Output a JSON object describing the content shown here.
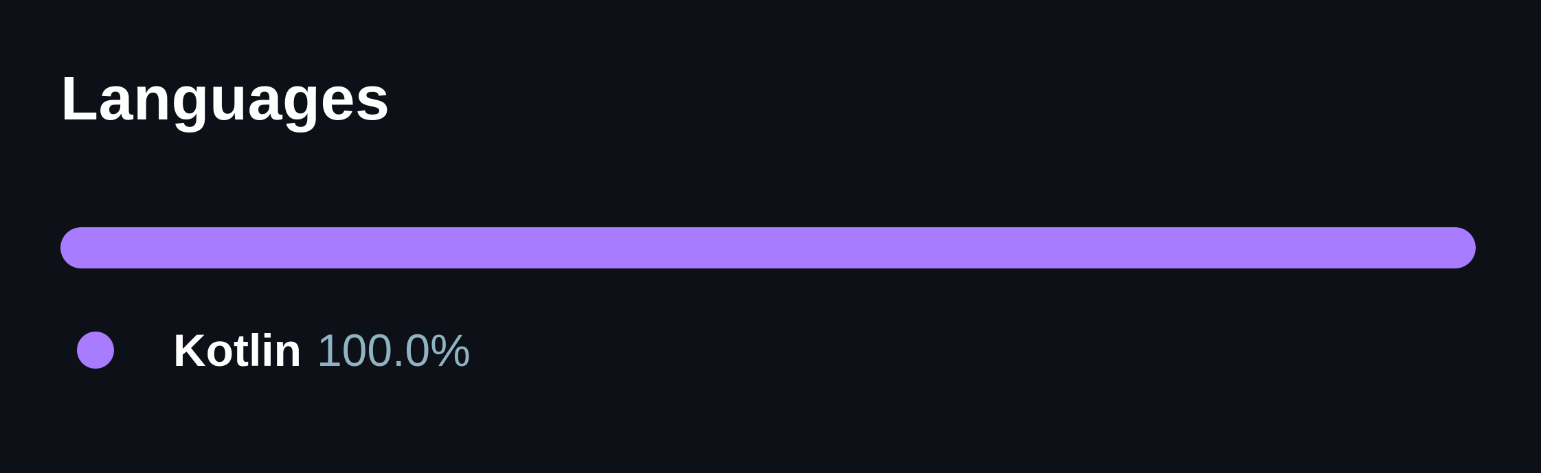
{
  "section": {
    "title": "Languages"
  },
  "languages": [
    {
      "name": "Kotlin",
      "percent_label": "100.0%",
      "percent": 100.0,
      "color": "#a97bff"
    }
  ]
}
